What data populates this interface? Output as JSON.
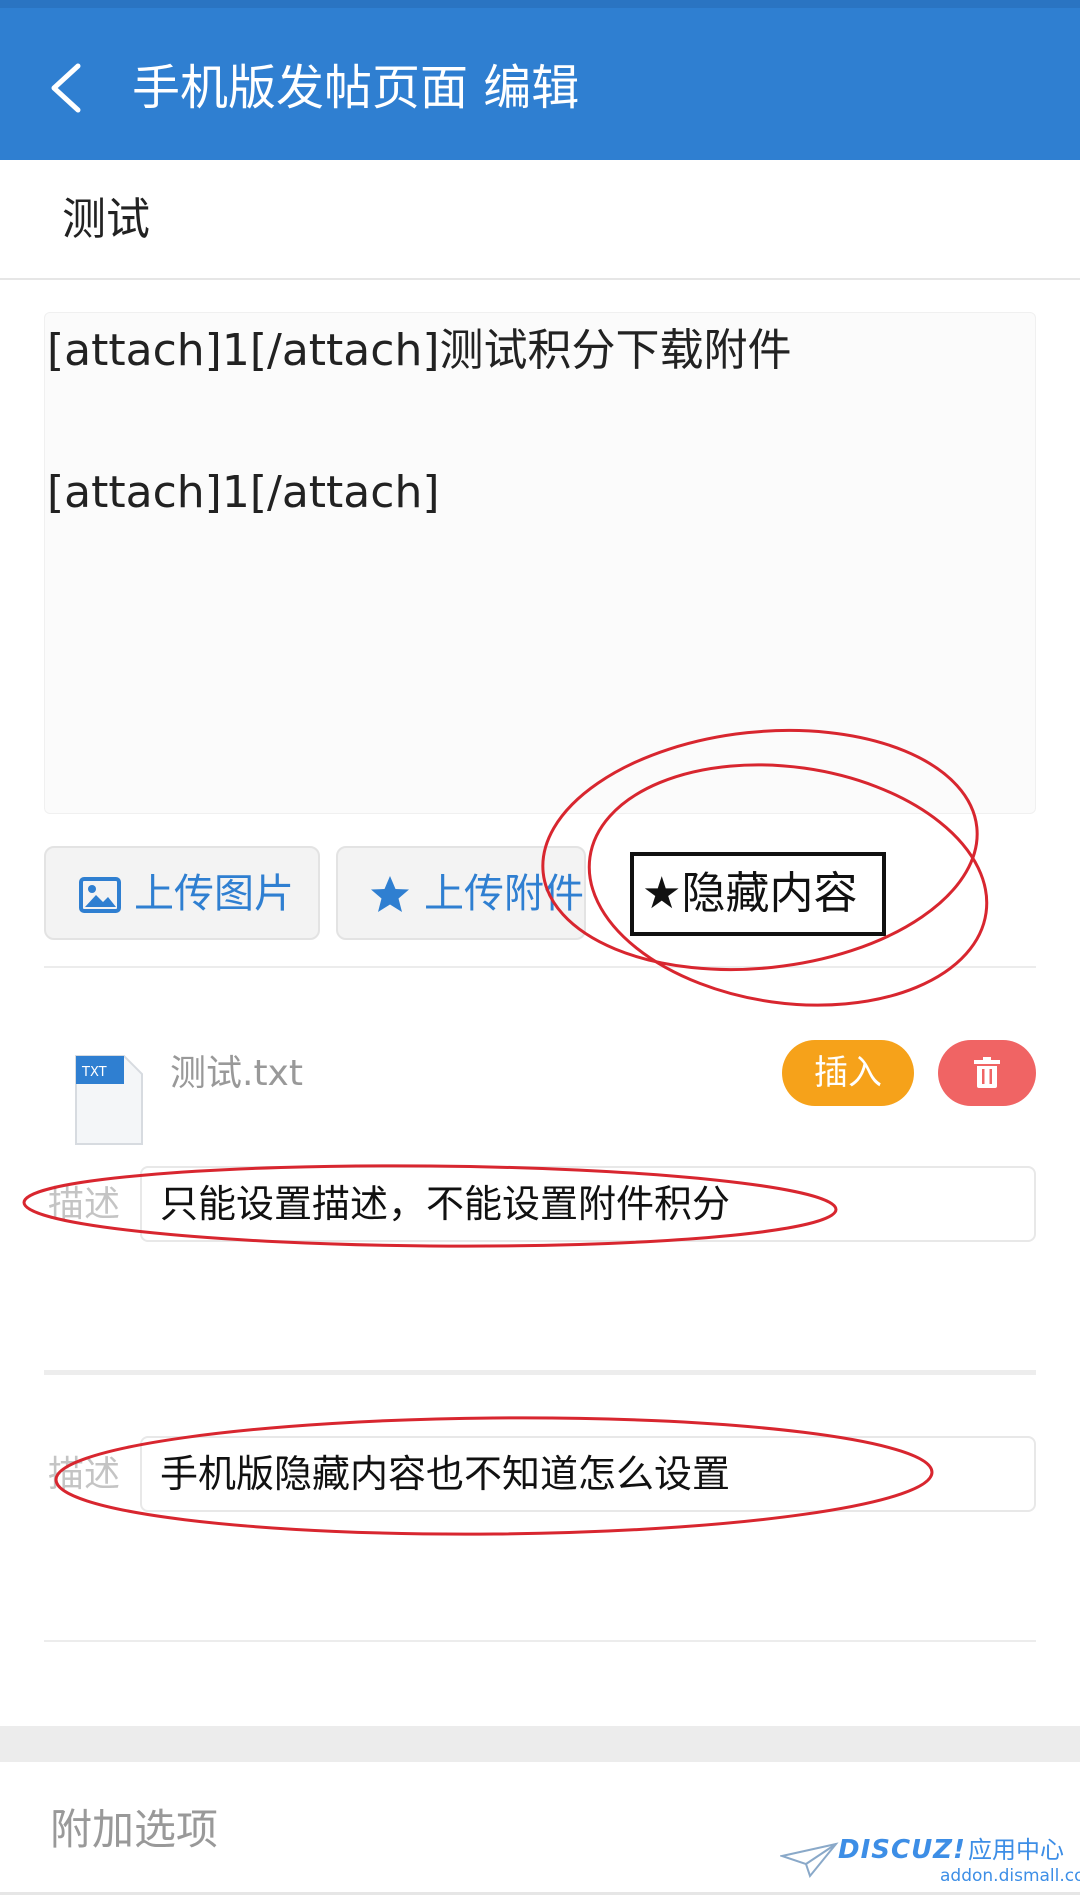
{
  "header": {
    "title": "手机版发帖页面 编辑"
  },
  "post": {
    "title": "测试",
    "content_lines": [
      "[attach]1[/attach]测试积分下载附件",
      "[attach]1[/attach]"
    ]
  },
  "toolbar": {
    "upload_image_label": "上传图片",
    "upload_attach_label": "上传附件",
    "hidden_content_label": "★隐藏内容"
  },
  "attachment": {
    "file_name": "测试.txt",
    "insert_label": "插入",
    "desc_label": "描述",
    "desc_value": "只能设置描述，不能设置附件积分"
  },
  "attachment2": {
    "desc_label": "描述",
    "desc_value": "手机版隐藏内容也不知道怎么设置"
  },
  "extra": {
    "label": "附加选项"
  },
  "watermark": {
    "brand": "DISCUZ!",
    "cn": "应用中心",
    "domain": "addon.dismall.com"
  },
  "colors": {
    "header": "#2f7fd1",
    "accent_blue": "#2f7fd1",
    "insert_orange": "#f6a21a",
    "delete_red": "#f06464",
    "annotation_red": "#d8262f"
  }
}
